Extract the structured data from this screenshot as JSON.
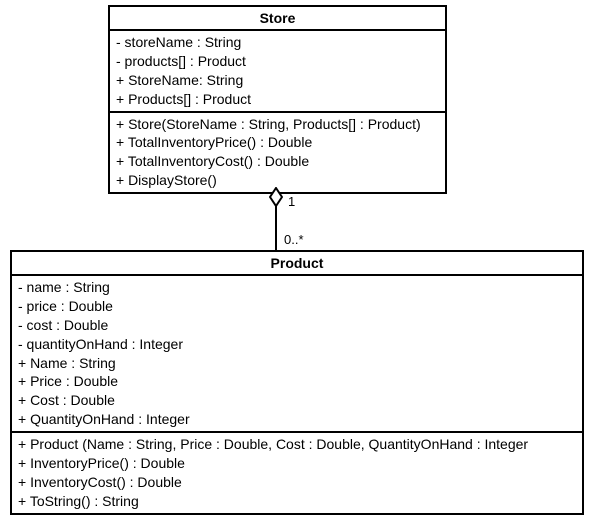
{
  "store": {
    "title": "Store",
    "attrs": [
      "- storeName : String",
      "- products[] : Product",
      "+ StoreName: String",
      "+ Products[] : Product"
    ],
    "ops": [
      "+ Store(StoreName : String, Products[] : Product)",
      "+ TotalInventoryPrice() : Double",
      "+ TotalInventoryCost() : Double",
      "+ DisplayStore()"
    ]
  },
  "product": {
    "title": "Product",
    "attrs": [
      "- name : String",
      "- price : Double",
      "- cost : Double",
      "- quantityOnHand : Integer",
      "+ Name : String",
      "+ Price : Double",
      "+ Cost : Double",
      "+ QuantityOnHand : Integer"
    ],
    "ops": [
      "+ Product (Name : String, Price : Double, Cost : Double, QuantityOnHand : Integer",
      "+ InventoryPrice() : Double",
      "+ InventoryCost() : Double",
      "+ ToString() : String"
    ]
  },
  "relation": {
    "top_mult": "1",
    "bottom_mult": "0..*"
  },
  "chart_data": {
    "type": "uml_class_diagram",
    "classes": [
      {
        "name": "Store",
        "attributes": [
          {
            "visibility": "-",
            "name": "storeName",
            "type": "String"
          },
          {
            "visibility": "-",
            "name": "products[]",
            "type": "Product"
          },
          {
            "visibility": "+",
            "name": "StoreName",
            "type": "String"
          },
          {
            "visibility": "+",
            "name": "Products[]",
            "type": "Product"
          }
        ],
        "operations": [
          {
            "visibility": "+",
            "signature": "Store(StoreName : String, Products[] : Product)"
          },
          {
            "visibility": "+",
            "signature": "TotalInventoryPrice() : Double"
          },
          {
            "visibility": "+",
            "signature": "TotalInventoryCost() : Double"
          },
          {
            "visibility": "+",
            "signature": "DisplayStore()"
          }
        ]
      },
      {
        "name": "Product",
        "attributes": [
          {
            "visibility": "-",
            "name": "name",
            "type": "String"
          },
          {
            "visibility": "-",
            "name": "price",
            "type": "Double"
          },
          {
            "visibility": "-",
            "name": "cost",
            "type": "Double"
          },
          {
            "visibility": "-",
            "name": "quantityOnHand",
            "type": "Integer"
          },
          {
            "visibility": "+",
            "name": "Name",
            "type": "String"
          },
          {
            "visibility": "+",
            "name": "Price",
            "type": "Double"
          },
          {
            "visibility": "+",
            "name": "Cost",
            "type": "Double"
          },
          {
            "visibility": "+",
            "name": "QuantityOnHand",
            "type": "Integer"
          }
        ],
        "operations": [
          {
            "visibility": "+",
            "signature": "Product (Name : String, Price : Double, Cost : Double, QuantityOnHand : Integer"
          },
          {
            "visibility": "+",
            "signature": "InventoryPrice() : Double"
          },
          {
            "visibility": "+",
            "signature": "InventoryCost() : Double"
          },
          {
            "visibility": "+",
            "signature": "ToString() : String"
          }
        ]
      }
    ],
    "relationships": [
      {
        "type": "aggregation",
        "whole": "Store",
        "part": "Product",
        "whole_multiplicity": "1",
        "part_multiplicity": "0..*"
      }
    ]
  }
}
